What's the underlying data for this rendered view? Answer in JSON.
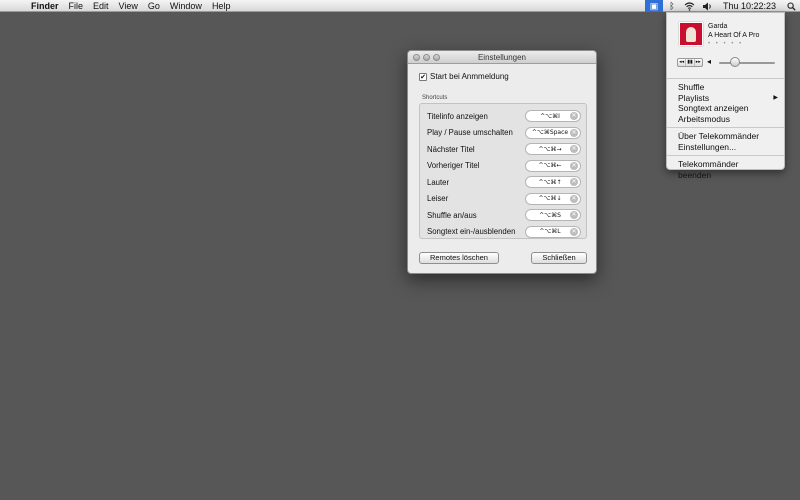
{
  "menubar": {
    "apple_icon": "apple-icon",
    "app_name": "Finder",
    "items": [
      "File",
      "Edit",
      "View",
      "Go",
      "Window",
      "Help"
    ],
    "clock": "Thu 10:22:23"
  },
  "status_menu": {
    "artist": "Garda",
    "track": "A Heart Of A Pro",
    "items": {
      "shuffle": "Shuffle",
      "playlists": "Playlists",
      "lyrics": "Songtext anzeigen",
      "work_mode": "Arbeitsmodus",
      "about": "Über Telekommänder",
      "settings": "Einstellungen...",
      "quit": "Telekommänder beenden"
    }
  },
  "window": {
    "title": "Einstellungen",
    "startup_label": "Start bei Anmmeldung",
    "startup_checked": true,
    "shortcuts_label": "Shortcuts",
    "shortcuts": [
      {
        "label": "Titelinfo anzeigen",
        "keys": "^⌥⌘I"
      },
      {
        "label": "Play / Pause umschalten",
        "keys": "^⌥⌘Space"
      },
      {
        "label": "Nächster Titel",
        "keys": "^⌥⌘→"
      },
      {
        "label": "Vorheriger Titel",
        "keys": "^⌥⌘←"
      },
      {
        "label": "Lauter",
        "keys": "^⌥⌘↑"
      },
      {
        "label": "Leiser",
        "keys": "^⌥⌘↓"
      },
      {
        "label": "Shuffle an/aus",
        "keys": "^⌥⌘S"
      },
      {
        "label": "Songtext ein-/ausblenden",
        "keys": "^⌥⌘L"
      }
    ],
    "remove_remotes": "Remotes löschen",
    "close": "Schließen"
  },
  "colors": {
    "desktop": "#575757",
    "menubar_active": "#2f6fd6",
    "album_art": "#c8102e"
  }
}
